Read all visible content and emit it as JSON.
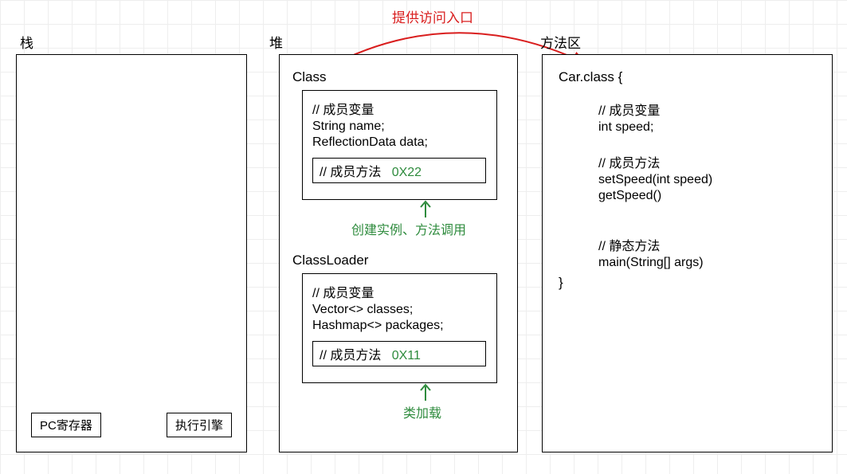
{
  "chart_data": {
    "type": "diagram",
    "title": "提供访问入口",
    "nodes": [
      {
        "id": "stack",
        "label": "栈",
        "children": [
          "PC寄存器",
          "执行引擎"
        ]
      },
      {
        "id": "heap",
        "label": "堆",
        "children": [
          {
            "id": "class",
            "label": "Class",
            "fields_comment": "// 成员变量",
            "fields": [
              "String name;",
              "ReflectionData data;"
            ],
            "methods_comment": "// 成员方法",
            "method_addr": "0X22",
            "note": "创建实例、方法调用"
          },
          {
            "id": "classloader",
            "label": "ClassLoader",
            "fields_comment": "// 成员变量",
            "fields": [
              "Vector<> classes;",
              "Hashmap<> packages;"
            ],
            "methods_comment": "// 成员方法",
            "method_addr": "0X11",
            "note": "类加载"
          }
        ]
      },
      {
        "id": "methodarea",
        "label": "方法区",
        "content": {
          "class_decl": "Car.class {",
          "fields_comment": "// 成员变量",
          "fields": [
            "int speed;"
          ],
          "methods_comment": "// 成员方法",
          "methods": [
            "setSpeed(int speed)",
            "getSpeed()"
          ],
          "static_comment": "// 静态方法",
          "static_methods": [
            "main(String[] args)"
          ],
          "close": "}"
        }
      }
    ],
    "edges": [
      {
        "from": "heap.class",
        "to": "methodarea",
        "label": "提供访问入口"
      }
    ]
  },
  "labels": {
    "stack": "栈",
    "heap": "堆",
    "method_area": "方法区",
    "arrow_label": "提供访问入口",
    "pc_register": "PC寄存器",
    "exec_engine": "执行引擎",
    "class_title": "Class",
    "classloader_title": "ClassLoader",
    "field_comment": "// 成员变量",
    "method_comment": "// 成员方法",
    "static_comment": "// 静态方法",
    "class_field1": "String name;",
    "class_field2": "ReflectionData data;",
    "class_addr": "0X22",
    "class_note": "创建实例、方法调用",
    "loader_field1": "Vector<> classes;",
    "loader_field2": "Hashmap<> packages;",
    "loader_addr": "0X11",
    "loader_note": "类加载",
    "car_decl": "Car.class {",
    "car_field1": "int speed;",
    "car_method1": "setSpeed(int speed)",
    "car_method2": "getSpeed()",
    "car_static1": "main(String[] args)",
    "car_close": "}"
  }
}
